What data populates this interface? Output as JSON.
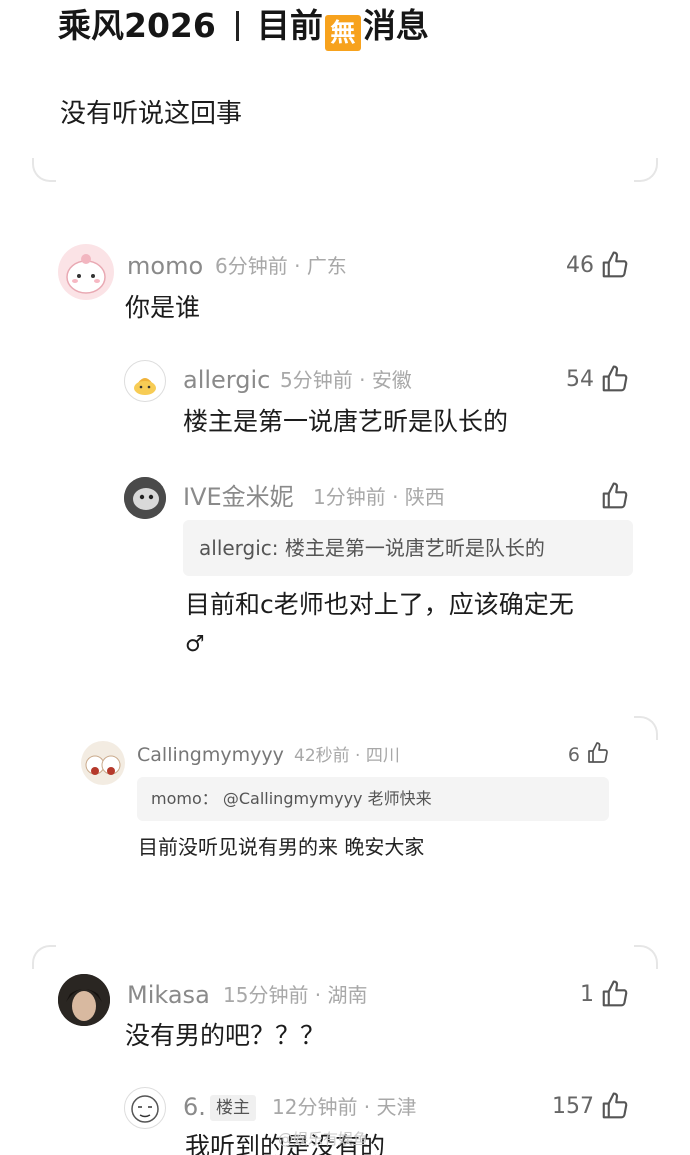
{
  "post": {
    "title_left": "乘风2026",
    "badge_char": "無",
    "title_mid": "目前",
    "title_right": "消息",
    "body": "没有听说这回事"
  },
  "comments": [
    {
      "name": "momo",
      "time": "6分钟前",
      "region": "广东",
      "likes": "46",
      "text": "你是谁",
      "replies": [
        {
          "name": "allergic",
          "time": "5分钟前",
          "region": "安徽",
          "likes": "54",
          "text": "楼主是第一说唐艺昕是队长的"
        },
        {
          "name": "IVE金米妮",
          "time": "1分钟前",
          "region": "陕西",
          "likes": "",
          "quote": "allergic: 楼主是第一说唐艺昕是队长的",
          "text_line1": "目前和c老师也对上了，应该确定无",
          "text_line2": "♂"
        }
      ]
    },
    {
      "name": "Callingmymyyy",
      "time": "42秒前",
      "region": "四川",
      "likes": "6",
      "quote_name": "momo：",
      "quote_text": "@Callingmymyyy 老师快来",
      "text": "目前没听见说有男的来 晚安大家"
    },
    {
      "name": "Mikasa",
      "time": "15分钟前",
      "region": "湖南",
      "likes": "1",
      "text": "没有男的吧？？？",
      "replies": [
        {
          "name": "6.",
          "tag": "楼主",
          "time": "12分钟前",
          "region": "天津",
          "likes": "157",
          "text": "我听到的是没有的"
        }
      ]
    }
  ],
  "watermark": "@娱乐有娱鱼",
  "icons": {
    "like": "thumbs-up-icon"
  },
  "colors": {
    "badge": "#f7a21d",
    "username": "#8a8a8a",
    "meta": "#a8a8a8"
  }
}
